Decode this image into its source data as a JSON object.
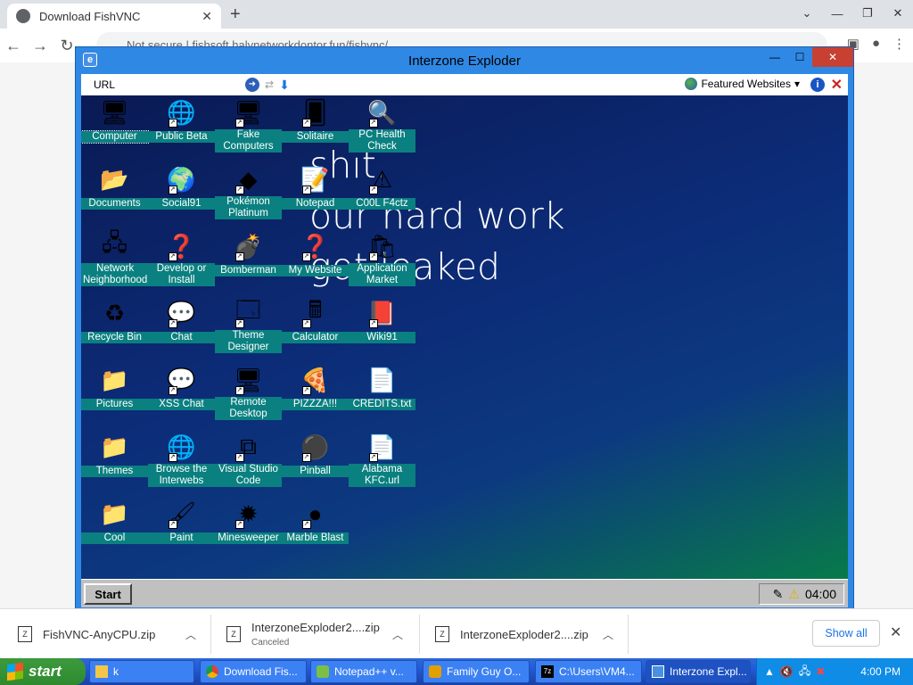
{
  "browser": {
    "tab_title": "Download FishVNC",
    "tab_close": "✕",
    "new_tab": "+",
    "window_controls": [
      "⌄",
      "—",
      "❐",
      "✕"
    ],
    "address_text": "Not secure | fishsoft.halynetworkdontor.fun/fishvnc/",
    "back": "←",
    "forward": "→",
    "reload": "↻"
  },
  "ie": {
    "title": "Interzone Exploder",
    "url_label": "URL",
    "featured": "Featured Websites",
    "controls": [
      "—",
      "☐",
      "✕"
    ]
  },
  "desktop": {
    "message_lines": [
      "shit.",
      "our hard work",
      "got leaked"
    ],
    "icons": [
      {
        "label": "Computer",
        "glyph": "🖥",
        "shortcut": false,
        "selected": true
      },
      {
        "label": "Public Beta",
        "glyph": "🌐",
        "shortcut": true
      },
      {
        "label": "Fake Computers",
        "glyph": "🖥",
        "shortcut": true
      },
      {
        "label": "Solitaire",
        "glyph": "🂠",
        "shortcut": true
      },
      {
        "label": "PC Health Check",
        "glyph": "🔍",
        "shortcut": true
      },
      {
        "label": "Documents",
        "glyph": "📂",
        "shortcut": false
      },
      {
        "label": "Social91",
        "glyph": "🌍",
        "shortcut": true
      },
      {
        "label": "Pokémon Platinum",
        "glyph": "◆",
        "shortcut": true
      },
      {
        "label": "Notepad",
        "glyph": "📝",
        "shortcut": true
      },
      {
        "label": "C00L F4ctz",
        "glyph": "⚠",
        "shortcut": true
      },
      {
        "label": "Network Neighborhood",
        "glyph": "🖧",
        "shortcut": false
      },
      {
        "label": "Develop or Install",
        "glyph": "❓",
        "shortcut": true
      },
      {
        "label": "Bomberman",
        "glyph": "💣",
        "shortcut": true
      },
      {
        "label": "My Website",
        "glyph": "❓",
        "shortcut": true
      },
      {
        "label": "Application Market",
        "glyph": "🛍",
        "shortcut": true
      },
      {
        "label": "Recycle Bin",
        "glyph": "♻",
        "shortcut": false
      },
      {
        "label": "Chat",
        "glyph": "💬",
        "shortcut": true
      },
      {
        "label": "Theme Designer",
        "glyph": "🗔",
        "shortcut": true
      },
      {
        "label": "Calculator",
        "glyph": "🖩",
        "shortcut": true
      },
      {
        "label": "Wiki91",
        "glyph": "📕",
        "shortcut": true
      },
      {
        "label": "Pictures",
        "glyph": "📁",
        "shortcut": false
      },
      {
        "label": "XSS Chat",
        "glyph": "💬",
        "shortcut": true
      },
      {
        "label": "Remote Desktop",
        "glyph": "🖥",
        "shortcut": true
      },
      {
        "label": "PIZZZA!!!",
        "glyph": "🍕",
        "shortcut": true
      },
      {
        "label": "CREDITS.txt",
        "glyph": "📄",
        "shortcut": false
      },
      {
        "label": "Themes",
        "glyph": "📁",
        "shortcut": false
      },
      {
        "label": "Browse the Interwebs",
        "glyph": "🌐",
        "shortcut": true
      },
      {
        "label": "Visual Studio Code",
        "glyph": "⧉",
        "shortcut": true
      },
      {
        "label": "Pinball",
        "glyph": "⚫",
        "shortcut": true
      },
      {
        "label": "Alabama KFC.url",
        "glyph": "📄",
        "shortcut": true
      },
      {
        "label": "Cool",
        "glyph": "📁",
        "shortcut": false
      },
      {
        "label": "Paint",
        "glyph": "🖌",
        "shortcut": true
      },
      {
        "label": "Minesweeper",
        "glyph": "✹",
        "shortcut": true
      },
      {
        "label": "Marble Blast",
        "glyph": "●",
        "shortcut": true
      }
    ]
  },
  "inner_taskbar": {
    "start": "Start",
    "time": "04:00"
  },
  "downloads": [
    {
      "name": "FishVNC-AnyCPU.zip",
      "status": ""
    },
    {
      "name": "InterzoneExploder2....zip",
      "status": "Canceled"
    },
    {
      "name": "InterzoneExploder2....zip",
      "status": ""
    }
  ],
  "downloads_show_all": "Show all",
  "xp": {
    "start": "start",
    "tasks": [
      "k",
      "Download Fis...",
      "Notepad++ v...",
      "Family Guy O...",
      "C:\\Users\\VM4...",
      "Interzone Expl..."
    ],
    "clock": "4:00 PM"
  }
}
